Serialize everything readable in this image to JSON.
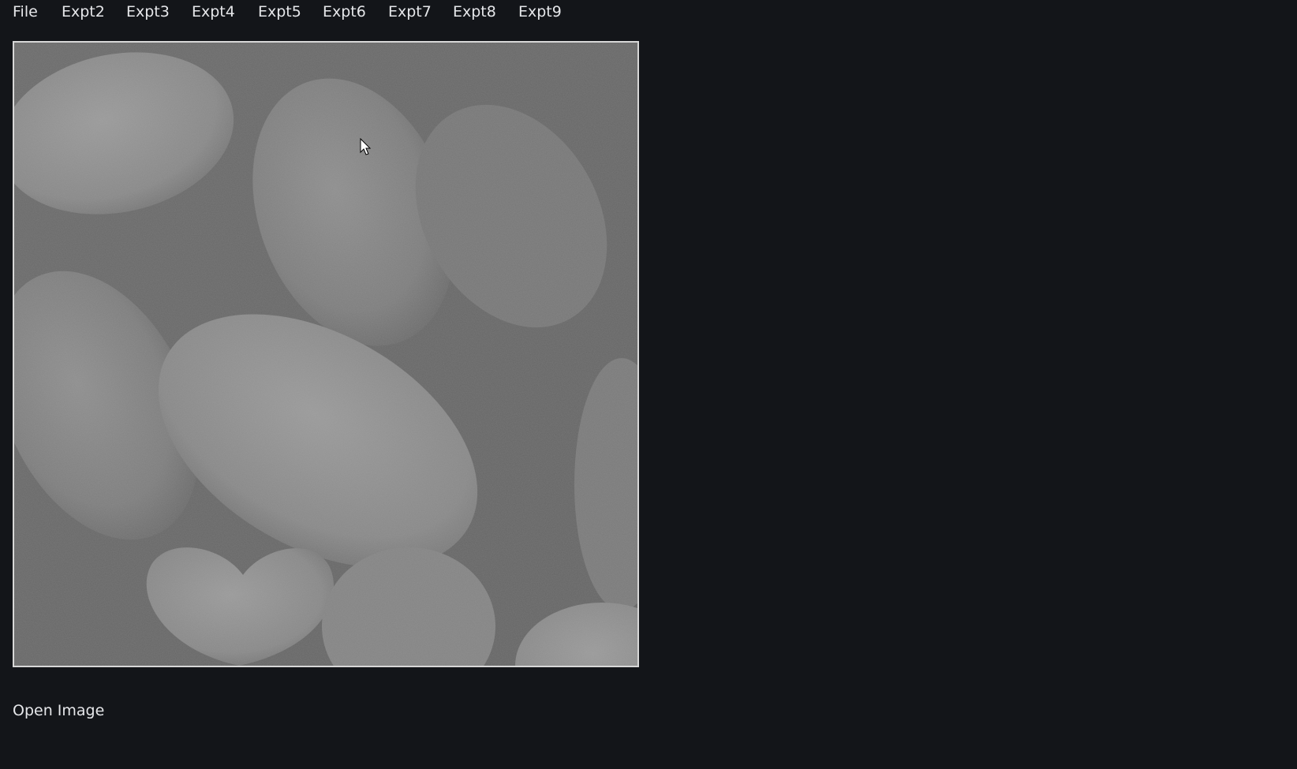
{
  "menubar": {
    "items": [
      {
        "label": "File"
      },
      {
        "label": "Expt2"
      },
      {
        "label": "Expt3"
      },
      {
        "label": "Expt4"
      },
      {
        "label": "Expt5"
      },
      {
        "label": "Expt6"
      },
      {
        "label": "Expt7"
      },
      {
        "label": "Expt8"
      },
      {
        "label": "Expt9"
      }
    ]
  },
  "image_view": {
    "subject": "grayscale photo of pills/beans"
  },
  "status": {
    "label": "Open Image"
  },
  "colors": {
    "background": "#131519",
    "text": "#e6e7ea",
    "frame_border": "#d7d7d7"
  }
}
